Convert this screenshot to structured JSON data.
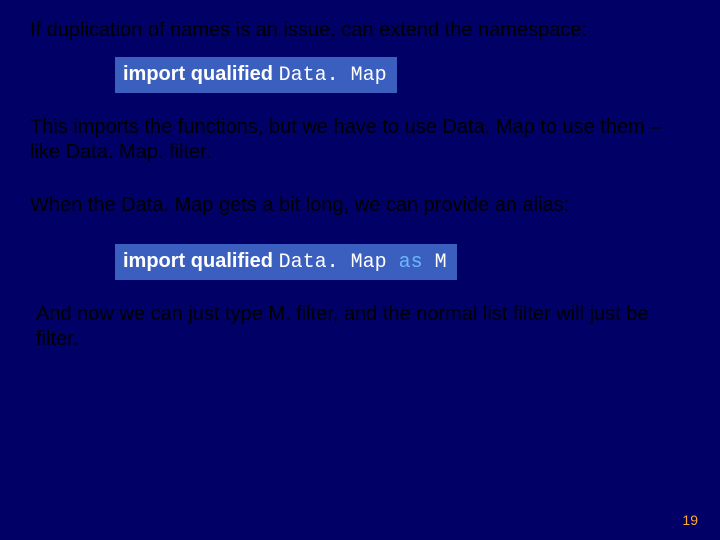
{
  "slide": {
    "para1": "If duplication of names is an issue, can extend the namespace:",
    "code1": {
      "kw": "import qualified ",
      "module": "Data. Map"
    },
    "para2": "This imports the functions, but we have to use Data. Map to use them – like Data. Map. filter.",
    "para3": "When the Data. Map gets a bit long, we can provide an alias:",
    "code2": {
      "kw": "import qualified ",
      "module": "Data. Map ",
      "as": "as ",
      "alias": "M"
    },
    "para4": "And now we can just type M. filter, and the normal list filter will just be filter.",
    "page_number": "19"
  }
}
